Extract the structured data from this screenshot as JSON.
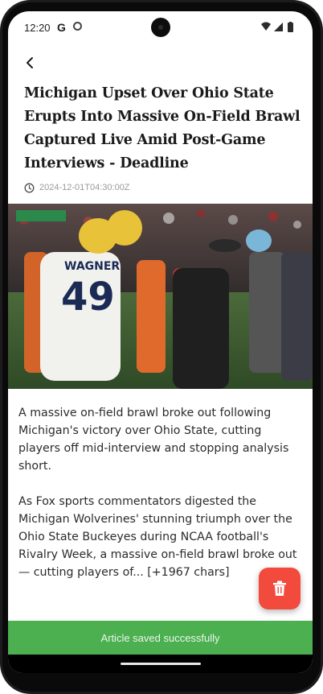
{
  "status_bar": {
    "time": "12:20",
    "notification_icons": [
      "google-g-icon",
      "circle-icon"
    ],
    "system_icons": [
      "wifi-icon",
      "signal-icon",
      "battery-icon"
    ]
  },
  "header": {
    "back_icon": "arrow-back-icon"
  },
  "article": {
    "title": "Michigan Upset Over Ohio State Erupts Into Massive On-Field Brawl Captured Live Amid Post-Game Interviews - Deadline",
    "timestamp": "2024-12-01T04:30:00Z",
    "paragraph_1": "A massive on-field brawl broke out following Michigan's victory over Ohio State, cutting players off mid-interview and stopping analysis short.",
    "paragraph_2": "As Fox sports commentators digested the Michigan Wolverines' stunning triumph over the Ohio State Buckeyes during NCAA football's Rivalry Week, a massive on-field brawl broke out — cutting players of... [+1967 chars]",
    "image": {
      "jersey_name": "WAGNER",
      "jersey_number": "49"
    }
  },
  "fab": {
    "icon": "trash-icon",
    "color": "#f24a3c"
  },
  "snackbar": {
    "message": "Article saved successfully",
    "color": "#4caf50"
  }
}
